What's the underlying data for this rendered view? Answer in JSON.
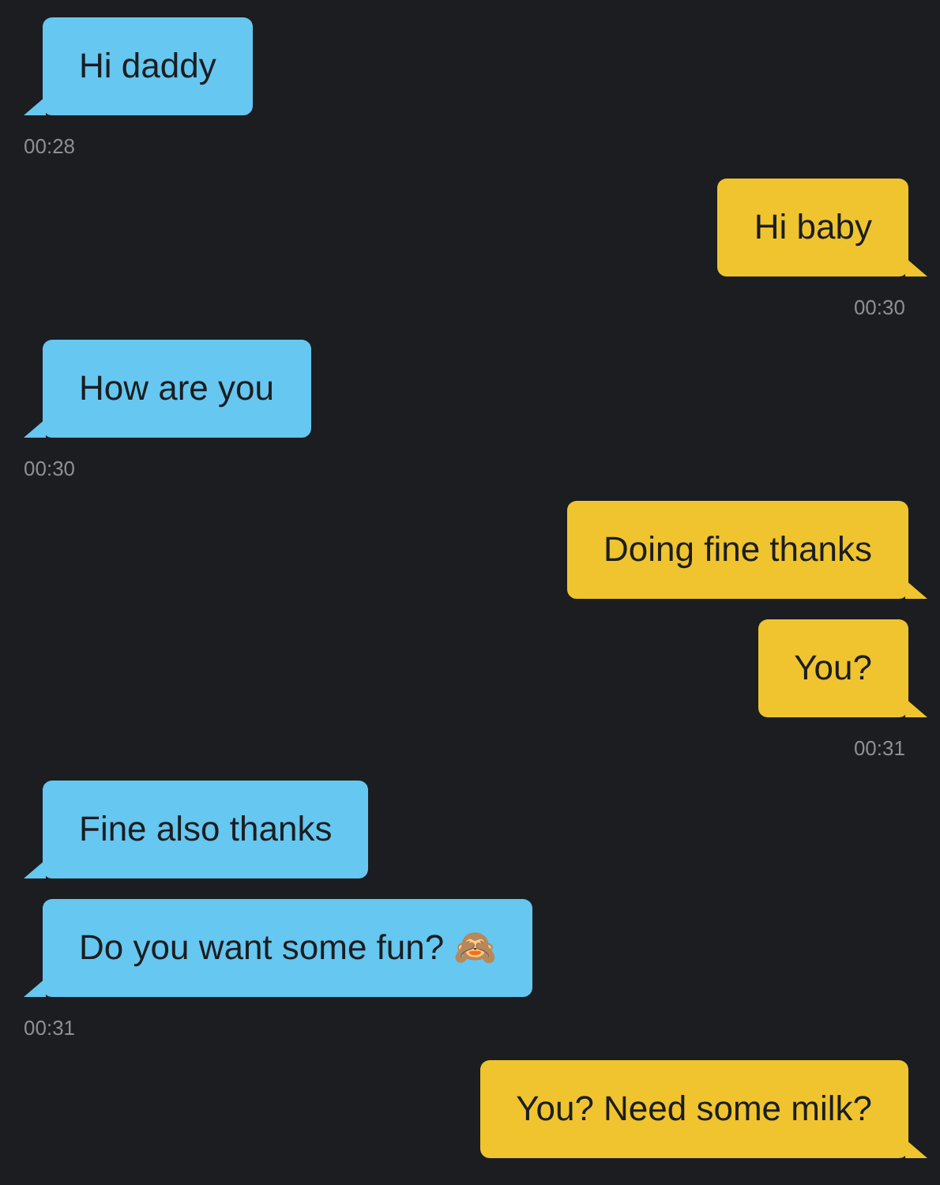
{
  "groups": [
    {
      "kind": "incoming",
      "messages": [
        "Hi daddy"
      ],
      "time": "00:28"
    },
    {
      "kind": "outgoing",
      "messages": [
        "Hi baby"
      ],
      "time": "00:30"
    },
    {
      "kind": "incoming",
      "messages": [
        "How are you"
      ],
      "time": "00:30"
    },
    {
      "kind": "outgoing",
      "messages": [
        "Doing fine thanks",
        "You?"
      ],
      "time": "00:31"
    },
    {
      "kind": "incoming",
      "messages": [
        "Fine also thanks",
        "Do you want some fun? 🙈"
      ],
      "time": "00:31"
    },
    {
      "kind": "outgoing",
      "messages": [
        "You? Need some milk?"
      ]
    }
  ]
}
